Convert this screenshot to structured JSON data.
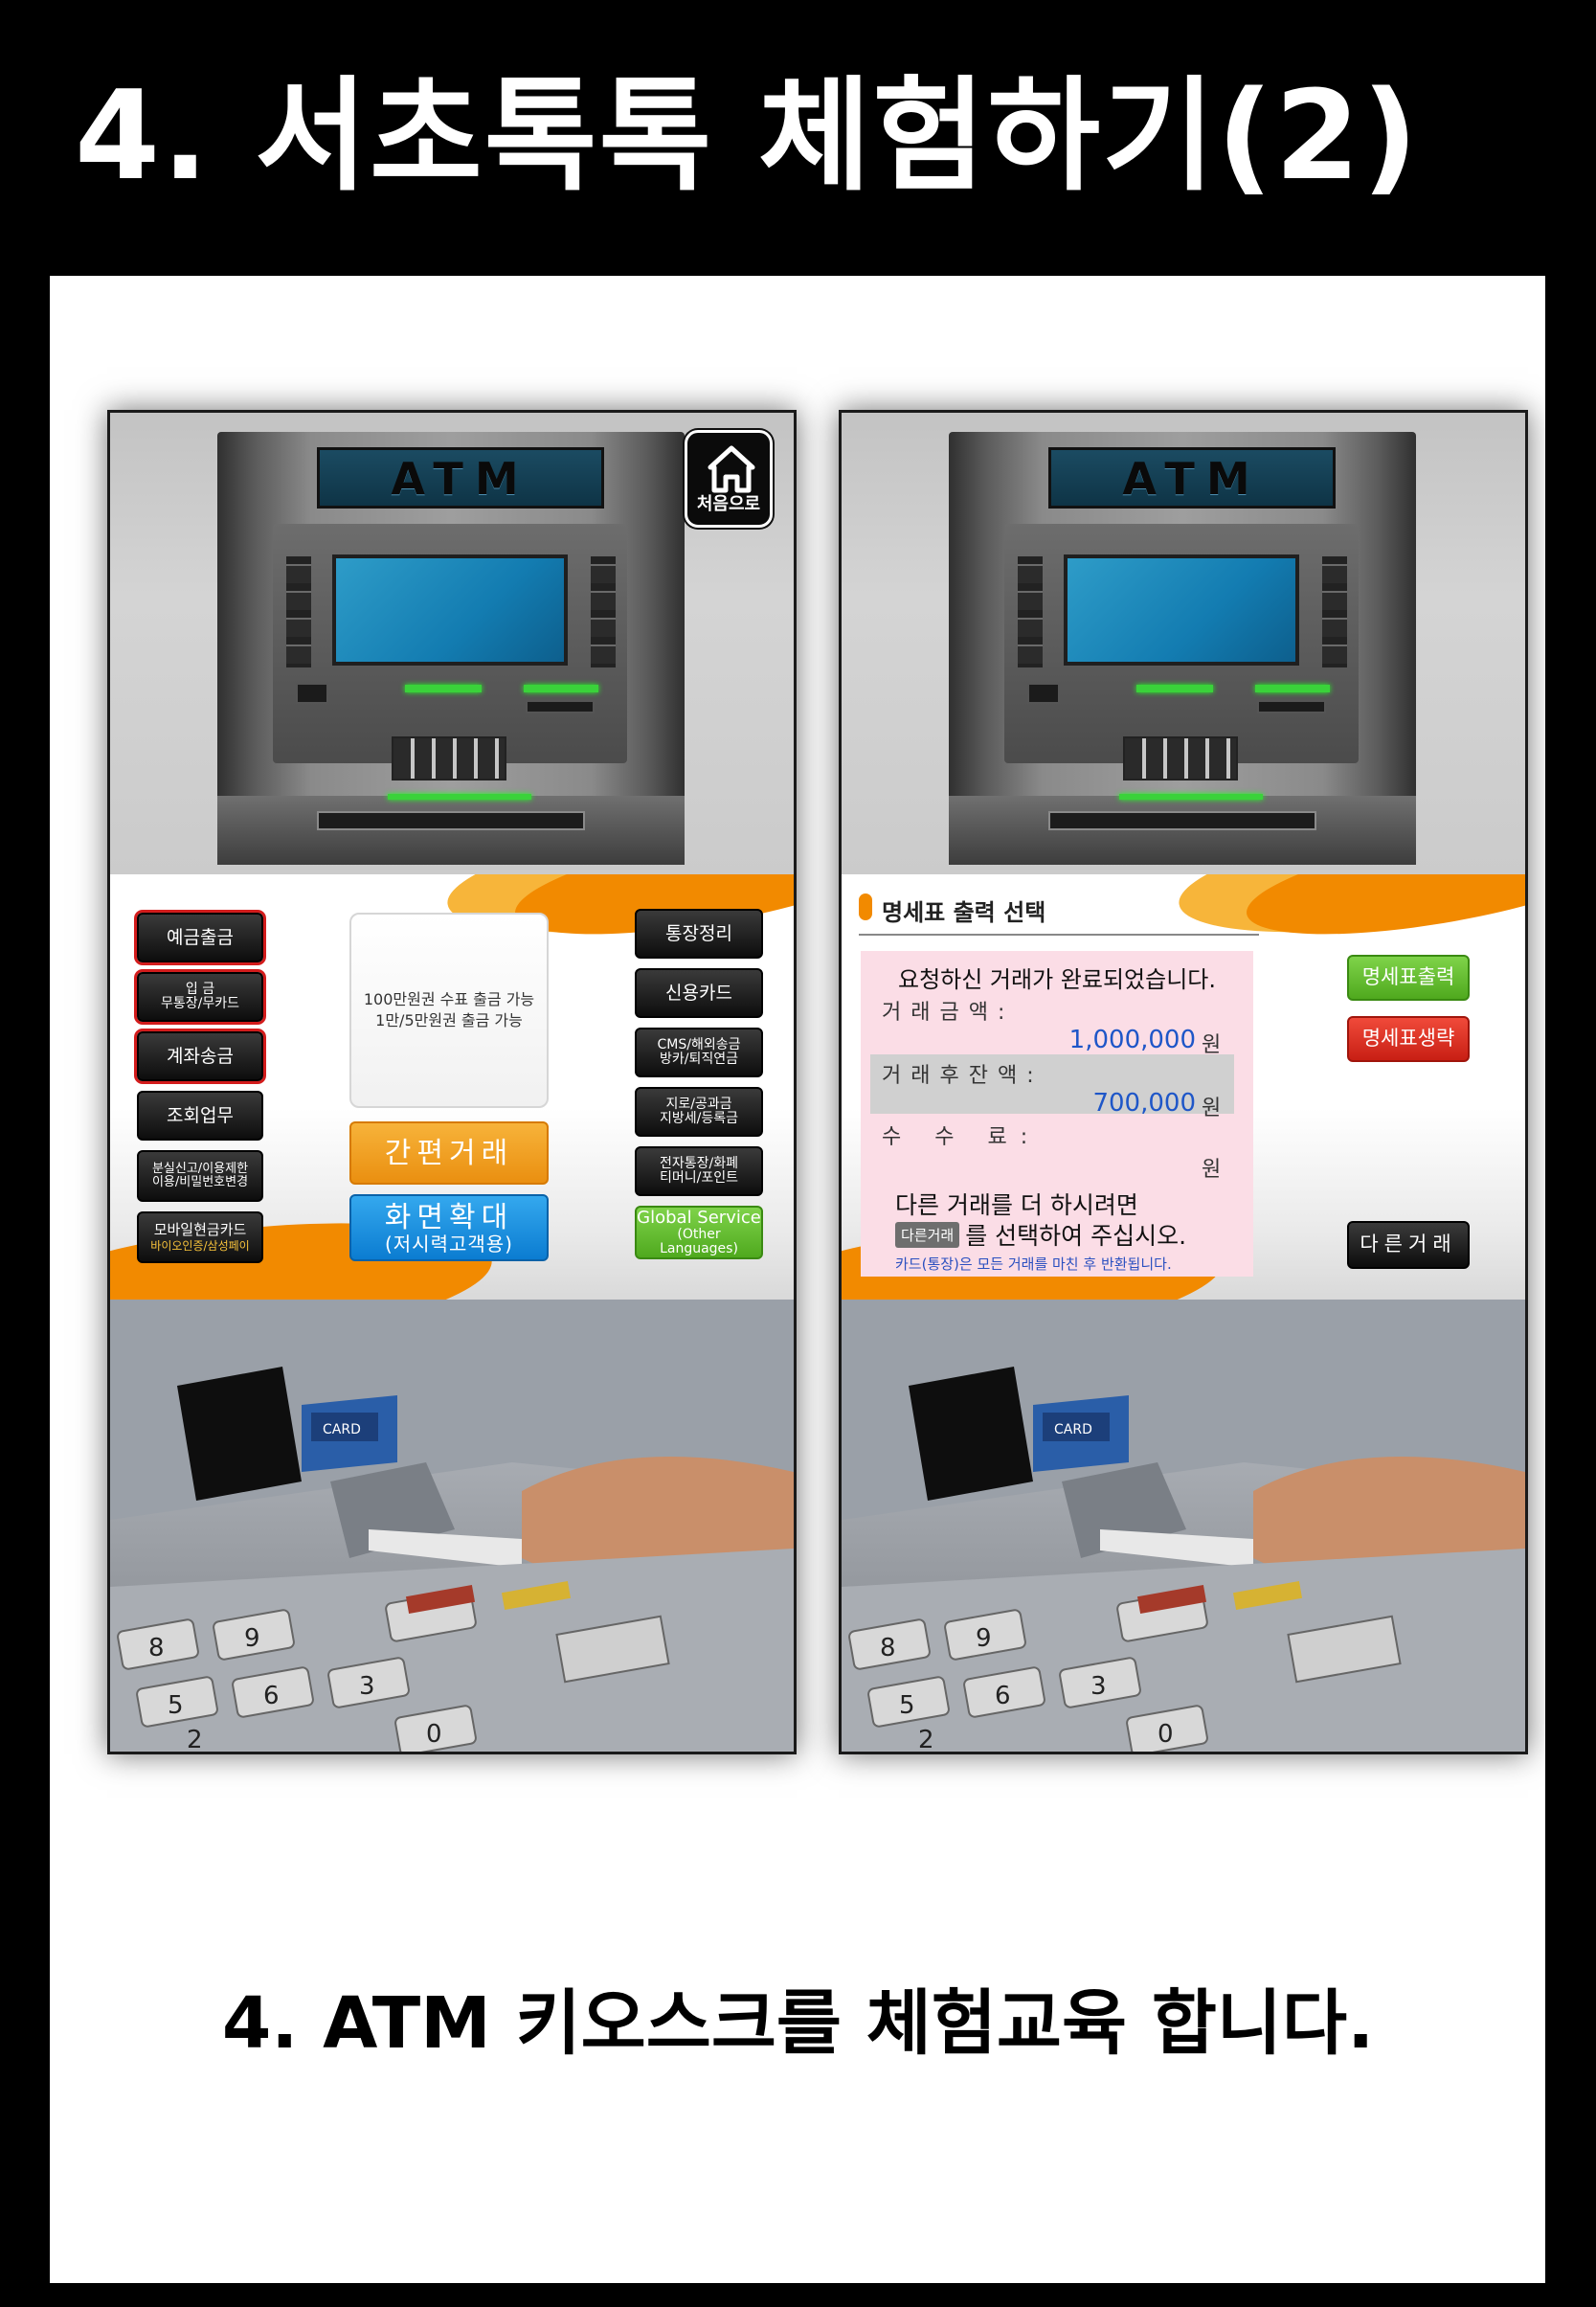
{
  "header": {
    "title": "4. 서초톡톡 체험하기(2)"
  },
  "caption": "4. ATM 키오스크를 체험교육 합니다.",
  "atm_sign": "ATM",
  "left_screen": {
    "home_label": "처음으로",
    "left_buttons": [
      "예금출금",
      "입 금\n무통장/무카드",
      "계좌송금",
      "조회업무",
      "분실신고/이용제한\n이용/비밀번호변경",
      "모바일현금카드\n바이오인증/삼성페이"
    ],
    "notice": "100만원권 수표 출금 가능\n1만/5만원권 출금 가능",
    "quick_button": "간편거래",
    "zoom_button": {
      "line1": "화면확대",
      "line2": "(저시력고객용)"
    },
    "right_buttons": [
      "통장정리",
      "신용카드",
      "CMS/해외송금\n방카/퇴직연금",
      "지로/공과금\n지방세/등록금",
      "전자통장/화폐\n티머니/포인트"
    ],
    "global_button": {
      "line1": "Global Service",
      "line2": "(Other Languages)"
    }
  },
  "right_screen": {
    "title": "명세표 출력 선택",
    "complete_msg": "요청하신 거래가 완료되었습니다.",
    "amount_label": "거래금액:",
    "amount_value": "1,000,000",
    "balance_label": "거래후잔액:",
    "balance_value": "700,000",
    "fee_label": "수 수 료:",
    "fee_value": "",
    "won": "원",
    "more_line1": "다른 거래를 더 하시려면",
    "more_chip": "다른거래",
    "more_line2": "를 선택하여 주십시오.",
    "card_notice": "카드(통장)은 모든 거래를 마친 후 반환됩니다.",
    "print_button": "명세표출력",
    "skip_button": "명세표생략",
    "other_button": "다른거래"
  },
  "photo_labels": {
    "card_label": "CARD",
    "keypad_digits": [
      "8",
      "9",
      "5",
      "6",
      "2",
      "3",
      "0"
    ]
  },
  "colors": {
    "accent_orange": "#f28a00",
    "screen_blue": "#137cb1",
    "btn_green": "#4fa91e",
    "btn_red": "#c81f14"
  }
}
